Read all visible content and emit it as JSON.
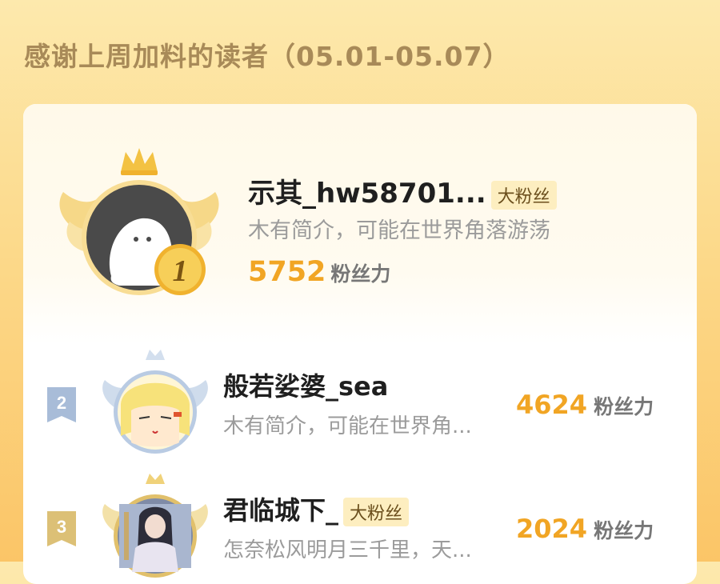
{
  "page": {
    "title": "感谢上周加料的读者（05.01-05.07）"
  },
  "badge_text": "大粉丝",
  "score_unit": "粉丝力",
  "top": {
    "rank": "1",
    "name": "示其_hw58701...",
    "bio": "木有简介，可能在世界角落游荡",
    "score": "5752",
    "has_badge": true
  },
  "rows": [
    {
      "rank": "2",
      "name": "般若娑婆_sea",
      "bio": "木有简介，可能在世界角...",
      "score": "4624",
      "has_badge": false,
      "rank_color": "#9fb4d2"
    },
    {
      "rank": "3",
      "name": "君临城下_",
      "bio": "怎奈松风明月三千里，天...",
      "score": "2024",
      "has_badge": true,
      "rank_color": "#d8b86a"
    }
  ],
  "colors": {
    "score": "#f1a524",
    "gold": "#f3c243",
    "silver": "#b9cbe3",
    "bronze": "#e1c06b"
  },
  "icons": {
    "crown": "crown-icon",
    "wings": "wings-icon",
    "rank_medal": "medal-icon"
  }
}
